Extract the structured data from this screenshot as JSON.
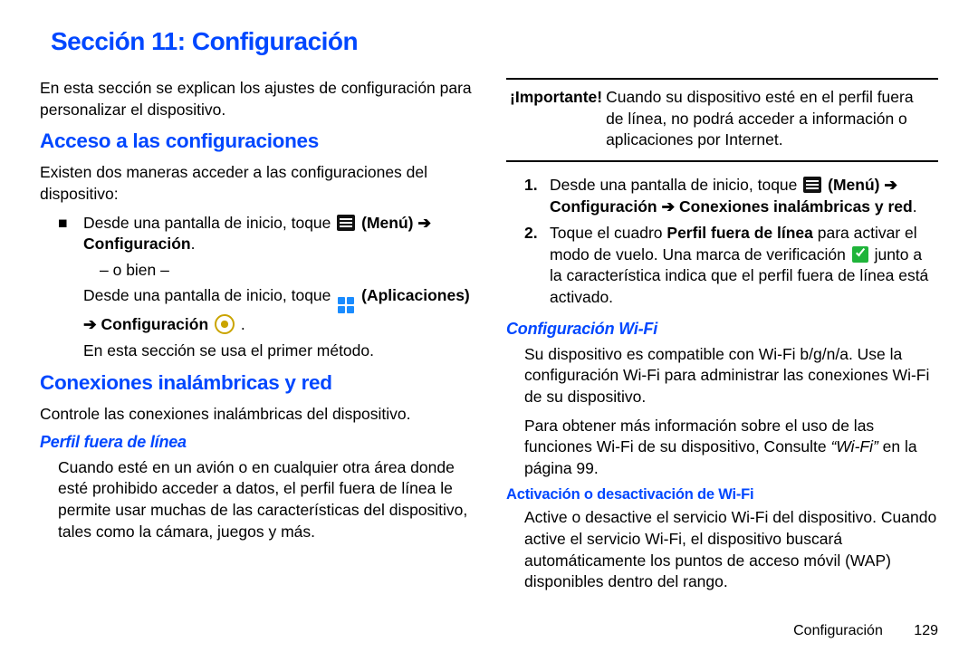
{
  "title": "Sección 11: Configuración",
  "left": {
    "intro": "En esta sección se explican los ajustes de configuración para personalizar el dispositivo.",
    "h_access": "Acceso a las configuraciones",
    "access_intro": "Existen dos maneras acceder a las configuraciones del dispositivo:",
    "bullet1_pre": "Desde una pantalla de inicio, toque ",
    "menu_label": " (Menú) ",
    "arrow": "➔",
    "config_bold": " Configuración",
    "period": ".",
    "or": "– o bien –",
    "bullet1b_pre": "Desde una pantalla de inicio, toque ",
    "apps_label": " (Aplicaciones)",
    "arrow2": " ➔ Configuración ",
    "method_note": "En esta sección se usa el primer método.",
    "h_wireless": "Conexiones inalámbricas y red",
    "wireless_intro": "Controle las conexiones inalámbricas del dispositivo.",
    "h_offline": "Perfil fuera de línea",
    "offline_body": "Cuando esté en un avión o en cualquier otra área donde esté prohibido acceder a datos, el perfil fuera de línea le permite usar muchas de las características del dispositivo, tales como la cámara, juegos y más."
  },
  "right": {
    "important_label": "¡Importante! ",
    "important_body": "Cuando su dispositivo esté en el perfil fuera de línea, no podrá acceder a información o aplicaciones por Internet.",
    "step1_pre": "Desde una pantalla de inicio, toque ",
    "step1_menu": " (Menú) ",
    "step1_path": "Configuración ➔ Conexiones inalámbricas y red",
    "step2_a": "Toque el cuadro ",
    "step2_bold": "Perfil fuera de línea",
    "step2_b": " para activar el modo de vuelo. Una marca de verificación ",
    "step2_c": " junto a la característica indica que el perfil fuera de línea está activado.",
    "h_wifi": "Configuración Wi-Fi",
    "wifi_p1": "Su dispositivo es compatible con Wi-Fi b/g/n/a. Use la configuración Wi-Fi para administrar las conexiones Wi-Fi de su dispositivo.",
    "wifi_p2a": "Para obtener más información sobre el uso de las funciones Wi-Fi de su dispositivo, Consulte ",
    "wifi_ref": "“Wi-Fi”",
    "wifi_p2b": " en la página 99.",
    "h_wifi_toggle": "Activación o desactivación de Wi-Fi",
    "wifi_toggle_body": "Active o desactive el servicio Wi-Fi del dispositivo. Cuando active el servicio Wi-Fi, el dispositivo buscará automáticamente los puntos de acceso móvil (WAP) disponibles dentro del rango."
  },
  "footer": {
    "label": "Configuración",
    "page": "129"
  }
}
